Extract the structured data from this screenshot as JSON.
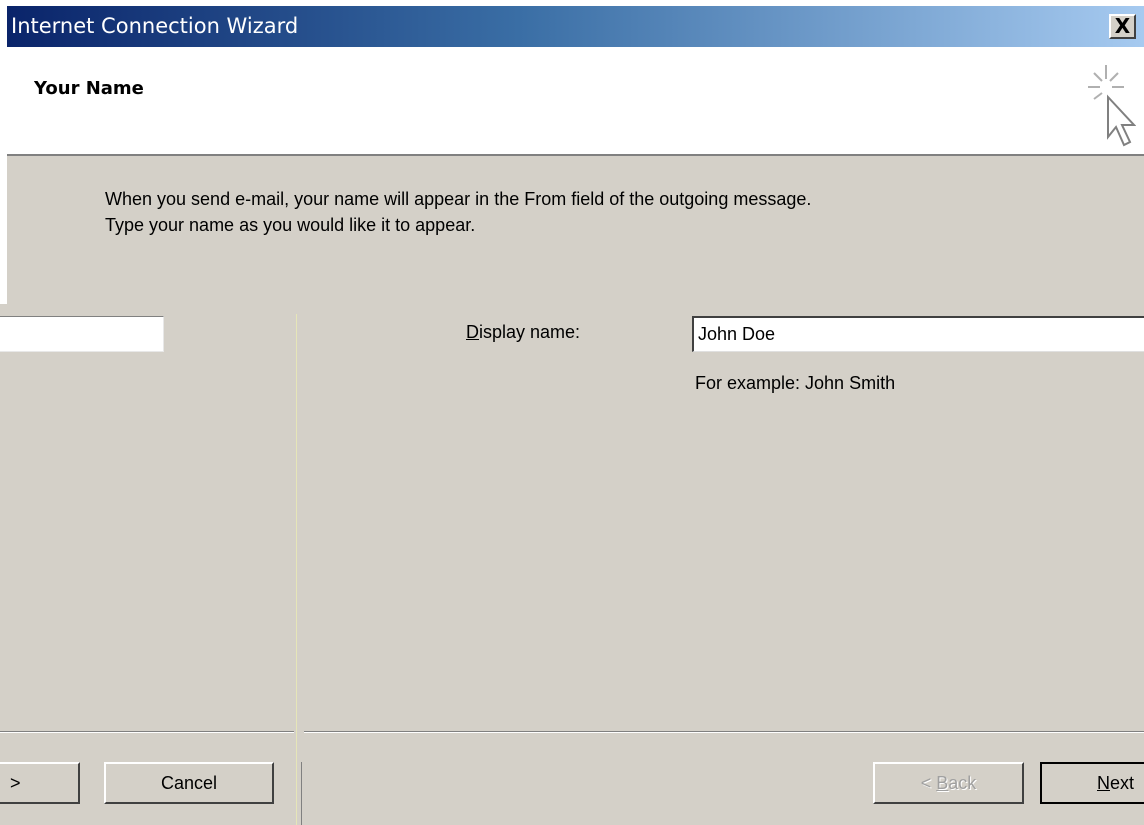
{
  "window": {
    "title": "Internet Connection Wizard",
    "close_label": "X"
  },
  "header": {
    "title": "Your Name",
    "icon": "wizard-cursor-icon"
  },
  "intro": {
    "line1": "When you send e-mail, your name will appear in the From field of the outgoing message.",
    "line2": "Type your name as you would like it to appear."
  },
  "form": {
    "display_name_label_accel": "D",
    "display_name_label_rest": "isplay name:",
    "display_name_value": "John Doe",
    "example_text": "For example: John Smith"
  },
  "buttons": {
    "prev_label": ">",
    "cancel_label": "Cancel",
    "back_prefix": "< ",
    "back_accel": "B",
    "back_rest": "ack",
    "next_accel": "N",
    "next_rest": "ext"
  },
  "colors": {
    "dialog_face": "#d4d0c8",
    "titlebar_start": "#0a246a",
    "titlebar_end": "#a6caf0"
  }
}
